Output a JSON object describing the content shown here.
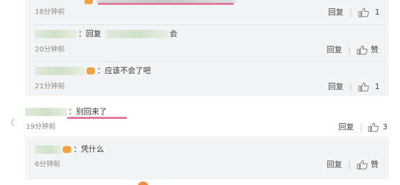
{
  "comments": [
    {
      "time": "18分钟前",
      "reply_label": "回复",
      "like_count": "1"
    },
    {
      "text_prefix": "：回复",
      "text_suffix": "会",
      "time": "20分钟前",
      "reply_label": "回复",
      "like_label": "赞"
    },
    {
      "text": "：应该不会了吧",
      "time": "21分钟前",
      "reply_label": "回复",
      "like_count": "1"
    },
    {
      "text": "：别回来了",
      "time": "19分钟前",
      "reply_label": "回复",
      "like_count": "3"
    },
    {
      "text": "：凭什么",
      "time": "6分钟前",
      "reply_label": "回复",
      "like_label": "赞"
    }
  ],
  "colors": {
    "highlight_underline": "#e07a9b",
    "nested_background": "#f3f4f5",
    "blurred_name": "#cfe1c9"
  },
  "icons": {
    "like": "thumbs-up-icon",
    "avatar_badge": "user-badge-icon",
    "side_arrow": "chevron-left-icon"
  }
}
